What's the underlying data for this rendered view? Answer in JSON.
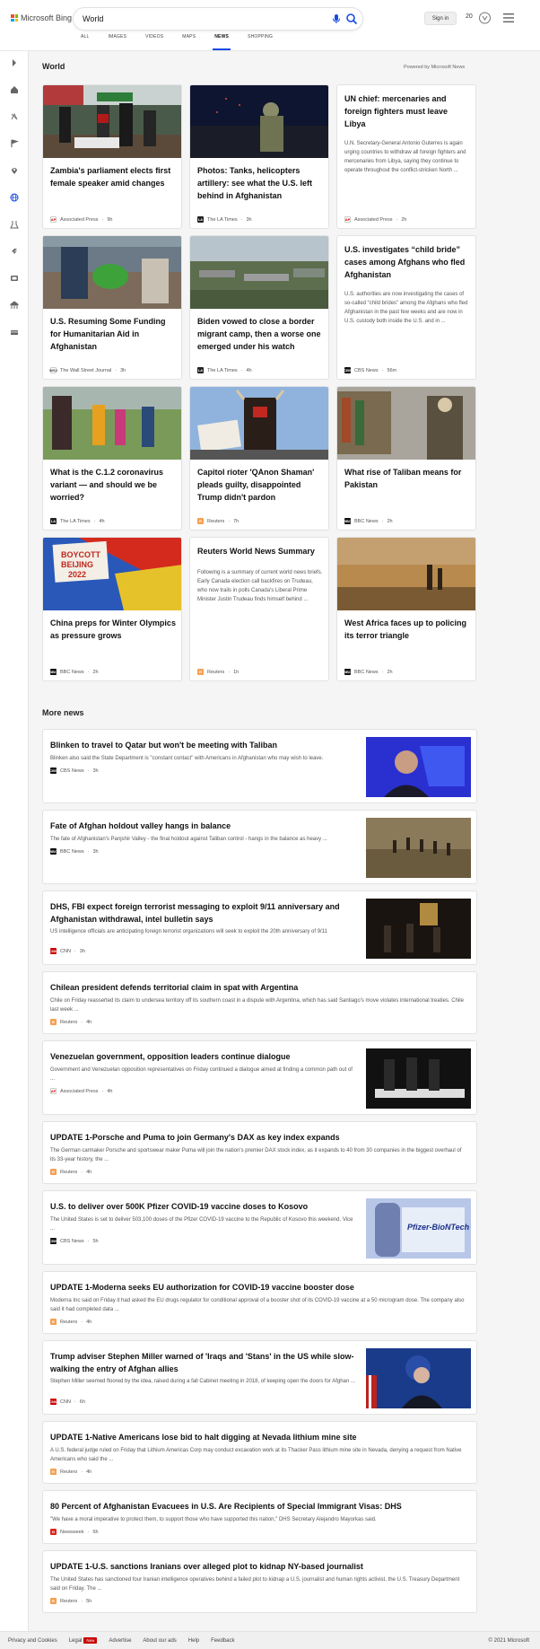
{
  "header": {
    "logo_text": "Microsoft Bing",
    "search_value": "World",
    "signin_label": "Sign in",
    "rewards_points": "20",
    "tabs": [
      {
        "label": "ALL"
      },
      {
        "label": "IMAGES"
      },
      {
        "label": "VIDEOS"
      },
      {
        "label": "MAPS"
      },
      {
        "label": "NEWS",
        "active": true
      },
      {
        "label": "SHOPPING"
      }
    ]
  },
  "colors": {
    "accent": "#174ae4",
    "bing_red": "#f25022",
    "bing_green": "#7fba00",
    "bing_blue": "#00a4ef",
    "bing_yellow": "#ffb900"
  },
  "rail_icons": [
    "chevron-right-icon",
    "home-icon",
    "explore-icon",
    "flag-icon",
    "location-icon",
    "globe-icon",
    "science-icon",
    "rocket-icon",
    "entertainment-icon",
    "sports-icon",
    "money-icon"
  ],
  "world": {
    "title": "World",
    "powered_by": "Powered by Microsoft News",
    "cards": [
      {
        "title": "Zambia's parliament elects first female speaker amid changes",
        "source": "Associated Press",
        "age": "9h",
        "logo": "AP"
      },
      {
        "title": "Photos: Tanks, helicopters artillery: see what the U.S. left behind in Afghanistan",
        "source": "The LA Times",
        "age": "3h",
        "logo": "LA"
      },
      {
        "title": "UN chief: mercenaries and foreign fighters must leave Libya",
        "snippet": "U.N. Secretary-General Antonio Guterres is again urging countries to withdraw all foreign fighters and mercenaries from Libya, saying they continue to operate throughout the conflict-stricken North ...",
        "source": "Associated Press",
        "age": "2h",
        "logo": "AP"
      },
      {
        "title": "U.S. Resuming Some Funding for Humanitarian Aid in Afghanistan",
        "source": "The Wall Street Journal",
        "age": "3h",
        "logo": "WSJ"
      },
      {
        "title": "Biden vowed to close a border migrant camp, then a worse one emerged under his watch",
        "source": "The LA Times",
        "age": "4h",
        "logo": "LA"
      },
      {
        "title": "U.S. investigates “child bride” cases among Afghans who fled Afghanistan",
        "snippet": "U.S. authorities are now investigating the cases of so-called “child brides” among the Afghans who fled Afghanistan in the past few weeks and are now in U.S. custody both inside the U.S. and in ...",
        "source": "CBS News",
        "age": "56m",
        "logo": "CBS"
      },
      {
        "title": "What is the C.1.2 coronavirus variant — and should we be worried?",
        "source": "The LA Times",
        "age": "4h",
        "logo": "LA"
      },
      {
        "title": "Capitol rioter 'QAnon Shaman' pleads guilty, disappointed Trump didn't pardon",
        "source": "Reuters",
        "age": "7h",
        "logo": "R"
      },
      {
        "title": "What rise of Taliban means for Pakistan",
        "source": "BBC News",
        "age": "2h",
        "logo": "BBC"
      },
      {
        "title": "China preps for Winter Olympics as pressure grows",
        "source": "BBC News",
        "age": "2h",
        "logo": "BBC",
        "image_text": "BOYCOTT BEIJING 2022"
      },
      {
        "title": "Reuters World News Summary",
        "snippet": "Following is a summary of current world news briefs. Early Canada election call backfires on Trudeau, who now trails in polls Canada's Liberal Prime Minister Justin Trudeau finds himself behind ...",
        "source": "Reuters",
        "age": "1h",
        "logo": "R"
      },
      {
        "title": "West Africa faces up to policing its terror triangle",
        "source": "BBC News",
        "age": "2h",
        "logo": "BBC"
      }
    ]
  },
  "more_news": {
    "title": "More news",
    "items": [
      {
        "title": "Blinken to travel to Qatar but won't be meeting with Taliban",
        "snippet": "Blinken also said the State Department is \"constant contact\" with Americans in Afghanistan who may wish to leave.",
        "source": "CBS News",
        "age": "3h",
        "logo": "CBS"
      },
      {
        "title": "Fate of Afghan holdout valley hangs in balance",
        "snippet": "The fate of Afghanistan's Panjshir Valley - the final holdout against Taliban control - hangs in the balance as heavy ...",
        "source": "BBC News",
        "age": "3h",
        "logo": "BBC"
      },
      {
        "title": "DHS, FBI expect foreign terrorist messaging to exploit 9/11 anniversary and Afghanistan withdrawal, intel bulletin says",
        "snippet": "US intelligence officials are anticipating foreign terrorist organizations will seek to exploit the 20th anniversary of 9/11",
        "source": "CNN",
        "age": "3h",
        "logo": "CNN"
      },
      {
        "title": "Chilean president defends territorial claim in spat with Argentina",
        "snippet": "Chile on Friday reasserted its claim to undersea territory off its southern coast in a dispute with Argentina, which has said Santiago's move violates international treaties. Chile last week ...",
        "source": "Reuters",
        "age": "4h",
        "logo": "R"
      },
      {
        "title": "Venezuelan government, opposition leaders continue dialogue",
        "snippet": "Government and Venezuelan opposition representatives on Friday continued a dialogue aimed at finding a common path out of ...",
        "source": "Associated Press",
        "age": "4h",
        "logo": "AP"
      },
      {
        "title": "UPDATE 1-Porsche and Puma to join Germany's DAX as key index expands",
        "snippet": "The German carmaker Porsche and sportswear maker Puma will join the nation's premier DAX stock index, as it expands to 40 from 30 companies in the biggest overhaul of its 33-year history, the ...",
        "source": "Reuters",
        "age": "4h",
        "logo": "R"
      },
      {
        "title": "U.S. to deliver over 500K Pfizer COVID-19 vaccine doses to Kosovo",
        "snippet": "The United States is set to deliver 503,100 doses of the Pfizer COVID-19 vaccine to the Republic of Kosovo this weekend. Vice ...",
        "source": "CBS News",
        "age": "5h",
        "logo": "CBS",
        "image_text": "Pfizer-BioNTech COV"
      },
      {
        "title": "UPDATE 1-Moderna seeks EU authorization for COVID-19 vaccine booster dose",
        "snippet": "Moderna Inc said on Friday it had asked the EU drugs regulator for conditional approval of a booster shot of its COVID-19 vaccine at a 50 microgram dose. The company also said it had completed data ...",
        "source": "Reuters",
        "age": "4h",
        "logo": "R"
      },
      {
        "title": "Trump adviser Stephen Miller warned of 'Iraqs and 'Stans' in the US while slow-walking the entry of Afghan allies",
        "snippet": "Stephen Miller seemed floored by the idea, raised during a fall Cabinet meeting in 2018, of keeping open the doors for Afghan ...",
        "source": "CNN",
        "age": "6h",
        "logo": "CNN"
      },
      {
        "title": "UPDATE 1-Native Americans lose bid to halt digging at Nevada lithium mine site",
        "snippet": "A U.S. federal judge ruled on Friday that Lithium Americas Corp may conduct excavation work at its Thacker Pass lithium mine site in Nevada, denying a request from Native Americans who said the ...",
        "source": "Reuters",
        "age": "4h",
        "logo": "R"
      },
      {
        "title": "80 Percent of Afghanistan Evacuees in U.S. Are Recipients of Special Immigrant Visas: DHS",
        "snippet": "\"We have a moral imperative to protect them, to support those who have supported this nation,\" DHS Secretary Alejandro Mayorkas said.",
        "source": "Newsweek",
        "age": "6h",
        "logo": "N"
      },
      {
        "title": "UPDATE 1-U.S. sanctions Iranians over alleged plot to kidnap NY-based journalist",
        "snippet": "The United States has sanctioned four Iranian intelligence operatives behind a failed plot to kidnap a U.S. journalist and human rights activist, the U.S. Treasury Department said on Friday. The ...",
        "source": "Reuters",
        "age": "5h",
        "logo": "R"
      }
    ]
  },
  "footer": {
    "links": [
      "Privacy and Cookies",
      "Legal",
      "Advertise",
      "About our ads",
      "Help",
      "Feedback"
    ],
    "new_badge": "New",
    "copyright": "© 2021 Microsoft"
  }
}
